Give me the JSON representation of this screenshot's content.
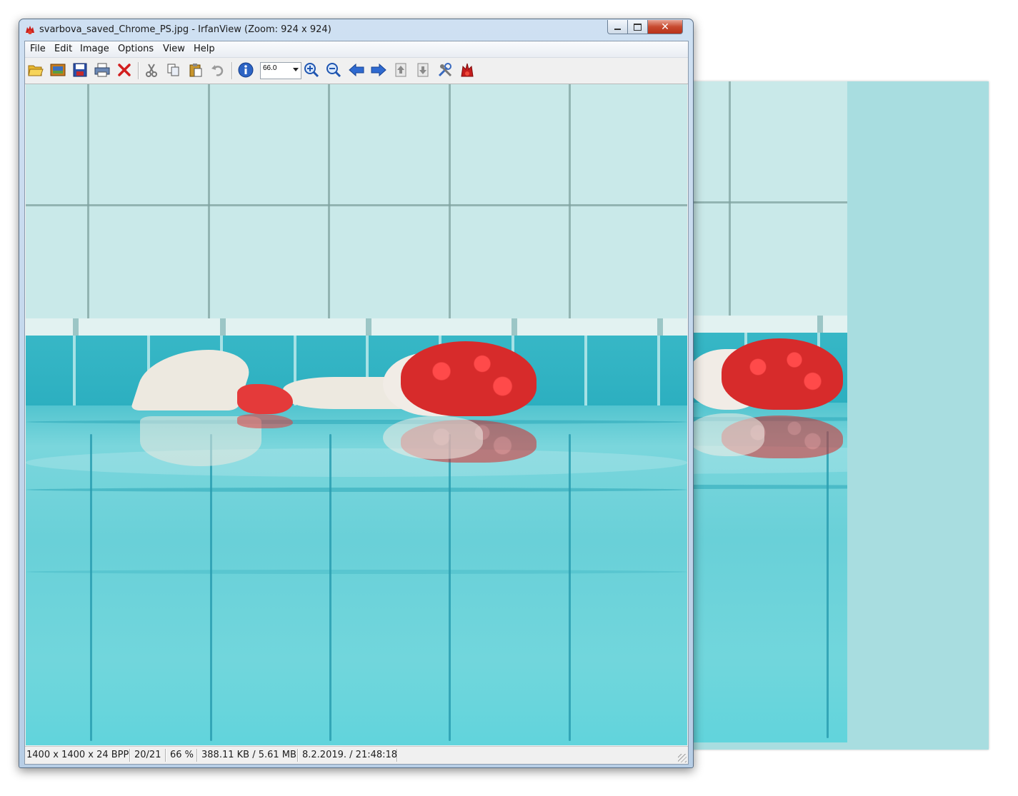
{
  "window": {
    "title": "svarbova_saved_Chrome_PS.jpg - IrfanView (Zoom: 924 x 924)",
    "app_icon": "irfanview-red-cat-icon",
    "controls": {
      "minimize": "minimize-icon",
      "maximize": "maximize-icon",
      "close": "close-icon"
    }
  },
  "menu": [
    "File",
    "Edit",
    "Image",
    "Options",
    "View",
    "Help"
  ],
  "toolbar": {
    "buttons": [
      {
        "name": "open-folder-icon"
      },
      {
        "name": "slideshow-icon"
      },
      {
        "name": "save-icon"
      },
      {
        "name": "print-icon"
      },
      {
        "name": "delete-icon"
      },
      {
        "name": "cut-icon"
      },
      {
        "name": "copy-icon"
      },
      {
        "name": "paste-icon"
      },
      {
        "name": "undo-icon"
      },
      {
        "name": "info-icon"
      },
      {
        "name": "zoom-in-icon"
      },
      {
        "name": "zoom-out-icon"
      },
      {
        "name": "previous-icon"
      },
      {
        "name": "next-icon"
      },
      {
        "name": "first-icon"
      },
      {
        "name": "last-icon"
      },
      {
        "name": "settings-icon"
      },
      {
        "name": "about-icon"
      }
    ],
    "zoom_value": "66.0"
  },
  "status": {
    "dimensions": "1400 x 1400 x 24 BPP",
    "index": "20/21",
    "zoom": "66 %",
    "size": "388.11 KB / 5.61 MB",
    "datetime": "8.2.2019. / 21:48:18"
  },
  "colors": {
    "titlebar": "#cfe0f2",
    "close_button": "#c74a2f",
    "pool_water": "#6fd3da",
    "tile_wall": "#c9e9e9",
    "swim_cap": "#d72b2b"
  }
}
